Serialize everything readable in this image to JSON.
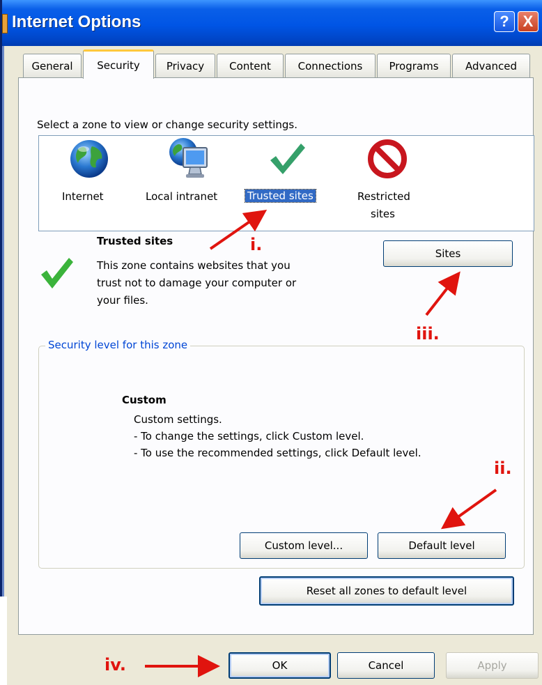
{
  "window": {
    "title": "Internet Options",
    "help_glyph": "?",
    "close_glyph": "X"
  },
  "tabs": [
    {
      "label": "General"
    },
    {
      "label": "Security"
    },
    {
      "label": "Privacy"
    },
    {
      "label": "Content"
    },
    {
      "label": "Connections"
    },
    {
      "label": "Programs"
    },
    {
      "label": "Advanced"
    }
  ],
  "active_tab": "Security",
  "security": {
    "zone_prompt": "Select a zone to view or change security settings.",
    "zones": [
      {
        "label": "Internet",
        "icon": "globe-icon"
      },
      {
        "label": "Local intranet",
        "icon": "computer-globe-icon"
      },
      {
        "label": "Trusted sites",
        "icon": "checkmark-icon",
        "selected": true
      },
      {
        "label_line1": "Restricted",
        "label_line2": "sites",
        "icon": "no-entry-icon"
      }
    ],
    "selected_zone": {
      "title": "Trusted sites",
      "desc_line1": "This zone contains websites that you",
      "desc_line2": "trust not to damage your computer or",
      "desc_line3": "your files."
    },
    "sites_button": "Sites",
    "level_group_title": "Security level for this zone",
    "level": {
      "title": "Custom",
      "line1": "Custom settings.",
      "line2": "- To change the settings, click Custom level.",
      "line3": "- To use the recommended settings, click Default level."
    },
    "custom_level_button": "Custom level...",
    "default_level_button": "Default level",
    "reset_button": "Reset all zones to default level"
  },
  "footer": {
    "ok": "OK",
    "cancel": "Cancel",
    "apply": "Apply"
  },
  "annotations": {
    "i": "i.",
    "ii": "ii.",
    "iii": "iii.",
    "iv": "iv."
  },
  "colors": {
    "titlebar": "#0055E5",
    "selection": "#316AC5",
    "annotation": "#E0140E",
    "group_title": "#0046D5"
  }
}
